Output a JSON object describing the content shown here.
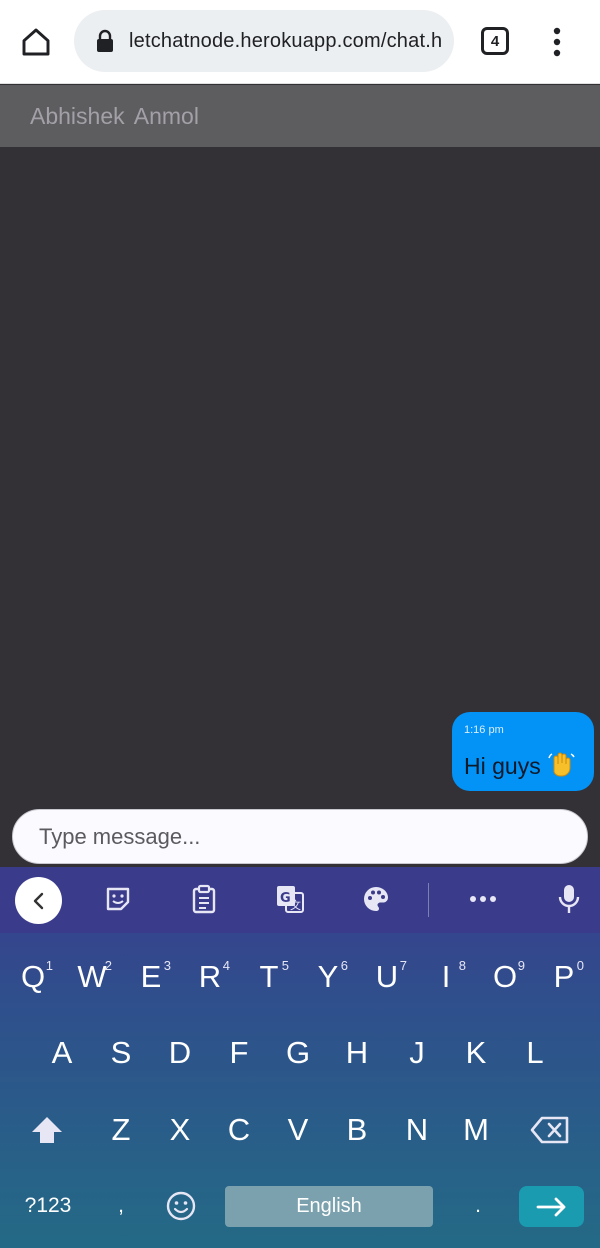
{
  "browser": {
    "url": "letchatnode.herokuapp.com/chat.h",
    "tab_count": "4"
  },
  "chat": {
    "title": "Abhishek  Anmol",
    "messages": [
      {
        "time": "1:16 pm",
        "text": "Hi guys"
      }
    ],
    "input_placeholder": "Type message..."
  },
  "keyboard": {
    "row1": [
      {
        "label": "Q",
        "hint": "1"
      },
      {
        "label": "W",
        "hint": "2"
      },
      {
        "label": "E",
        "hint": "3"
      },
      {
        "label": "R",
        "hint": "4"
      },
      {
        "label": "T",
        "hint": "5"
      },
      {
        "label": "Y",
        "hint": "6"
      },
      {
        "label": "U",
        "hint": "7"
      },
      {
        "label": "I",
        "hint": "8"
      },
      {
        "label": "O",
        "hint": "9"
      },
      {
        "label": "P",
        "hint": "0"
      }
    ],
    "row2": [
      "A",
      "S",
      "D",
      "F",
      "G",
      "H",
      "J",
      "K",
      "L"
    ],
    "row3": [
      "Z",
      "X",
      "C",
      "V",
      "B",
      "N",
      "M"
    ],
    "symbols_label": "?123",
    "comma_label": ",",
    "space_label": "English",
    "period_label": ".",
    "toolbar_icons": [
      "back-icon",
      "sticker-icon",
      "clipboard-icon",
      "translate-icon",
      "palette-icon",
      "more-icon",
      "mic-icon"
    ]
  },
  "colors": {
    "bubble": "#0392f5",
    "chat_bg": "#333135",
    "header_bg": "#5d5c5f",
    "keyboard_top": "#3b3b8c",
    "keyboard_bottom": "#246a86",
    "enter_key": "#1b9bb0"
  }
}
